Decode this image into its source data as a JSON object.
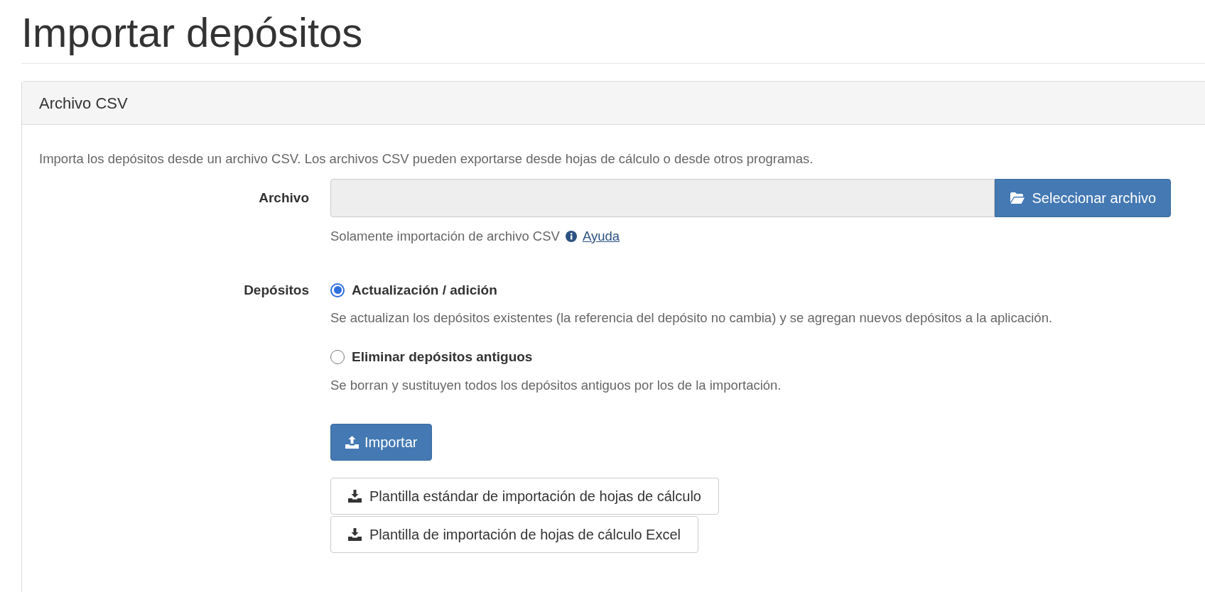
{
  "title": "Importar depósitos",
  "panel": {
    "heading": "Archivo CSV",
    "description": "Importa los depósitos desde un archivo CSV. Los archivos CSV pueden exportarse desde hojas de cálculo o desde otros programas.",
    "file": {
      "label": "Archivo",
      "button": "Seleccionar archivo",
      "help": "Solamente importación de archivo CSV",
      "help_link": "Ayuda"
    },
    "mode": {
      "label": "Depósitos",
      "options": [
        {
          "label": "Actualización / adición",
          "description": "Se actualizan los depósitos existentes (la referencia del depósito no cambia) y se agregan nuevos depósitos a la aplicación.",
          "selected": true
        },
        {
          "label": "Eliminar depósitos antiguos",
          "description": "Se borran y sustituyen todos los depósitos antiguos por los de la importación.",
          "selected": false
        }
      ]
    },
    "import_button": "Importar",
    "templates": [
      "Plantilla estándar de importación de hojas de cálculo",
      "Plantilla de importación de hojas de cálculo Excel"
    ]
  }
}
